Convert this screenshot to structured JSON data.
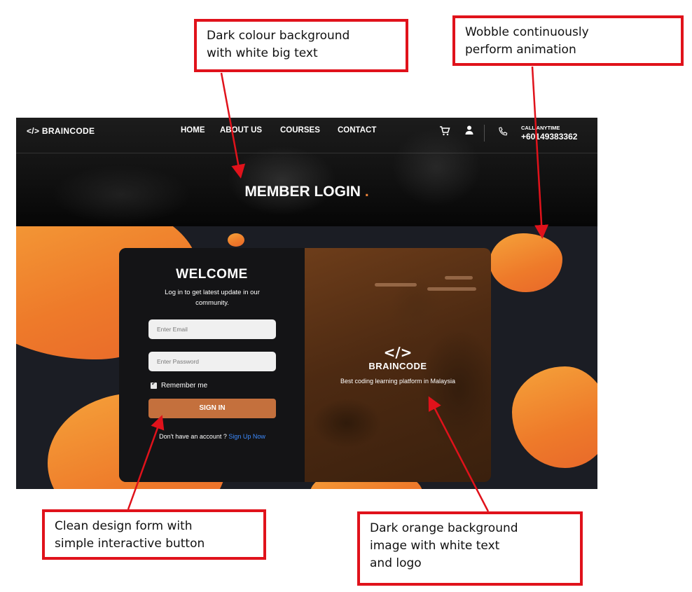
{
  "annotations": [
    {
      "line1": "Dark colour background",
      "line2": "with white big text",
      "line3": ""
    },
    {
      "line1": "Wobble continuously",
      "line2": "perform animation",
      "line3": ""
    },
    {
      "line1": "Clean design form with",
      "line2": "simple interactive button",
      "line3": ""
    },
    {
      "line1": "Dark orange background",
      "line2": "image with white text",
      "line3": "and logo"
    }
  ],
  "nav": {
    "logo": "</> BRAINCODE",
    "links": [
      "HOME",
      "ABOUT US",
      "COURSES",
      "CONTACT"
    ],
    "cart_icon": "cart-icon",
    "user_icon": "user-icon",
    "phone_icon": "phone-icon",
    "call_label": "CALL ANYTIME",
    "call_number": "+60149383362"
  },
  "hero": {
    "title": "MEMBER LOGIN",
    "title_dot": "."
  },
  "login": {
    "title": "WELCOME",
    "subtitle": "Log in to get latest update in our community.",
    "email_placeholder": "Enter Email",
    "password_placeholder": "Enter Password",
    "remember_label": "Remember me",
    "remember_checked": true,
    "signin_label": "SIGN IN",
    "signup_prompt": "Don't have an account ?",
    "signup_link": "Sign Up Now"
  },
  "promo": {
    "logo": "</>",
    "brand_name": "BRAINCODE",
    "tagline": "Best coding learning platform in Malaysia"
  },
  "colors": {
    "annotation_red": "#e0121b",
    "accent_orange": "#ee7a2a",
    "button": "#c4703d",
    "link": "#3d8bff"
  }
}
